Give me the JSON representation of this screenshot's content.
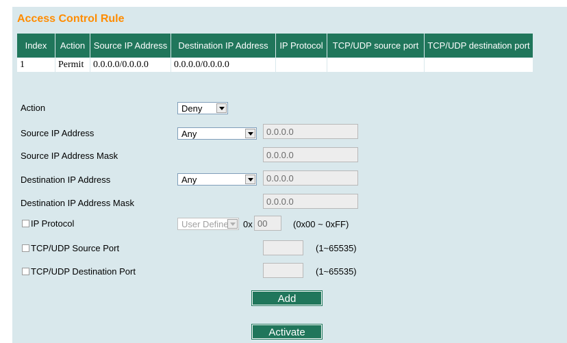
{
  "title": "Access Control Rule",
  "table": {
    "headers": [
      "Index",
      "Action",
      "Source IP Address",
      "Destination IP Address",
      "IP Protocol",
      "TCP/UDP source port",
      "TCP/UDP destination port"
    ],
    "rows": [
      [
        "1",
        "Permit",
        "0.0.0.0/0.0.0.0",
        "0.0.0.0/0.0.0.0",
        "",
        "",
        ""
      ]
    ]
  },
  "form": {
    "action": {
      "label": "Action",
      "value": "Deny"
    },
    "source_ip": {
      "label": "Source IP Address",
      "mode": "Any",
      "value": "0.0.0.0"
    },
    "source_mask": {
      "label": "Source IP Address Mask",
      "value": "0.0.0.0"
    },
    "dest_ip": {
      "label": "Destination IP Address",
      "mode": "Any",
      "value": "0.0.0.0"
    },
    "dest_mask": {
      "label": "Destination IP Address Mask",
      "value": "0.0.0.0"
    },
    "ip_protocol": {
      "label": "IP Protocol",
      "mode": "User Defined",
      "prefix": "0x",
      "value": "00",
      "range": "(0x00 ~ 0xFF)"
    },
    "src_port": {
      "label": "TCP/UDP Source Port",
      "value": "",
      "range": "(1~65535)"
    },
    "dst_port": {
      "label": "TCP/UDP Destination Port",
      "value": "",
      "range": "(1~65535)"
    }
  },
  "buttons": {
    "add": "Add",
    "activate": "Activate"
  },
  "colors": {
    "accent": "#20765b",
    "title": "#ff8c00",
    "panel": "#d9e8ec"
  }
}
